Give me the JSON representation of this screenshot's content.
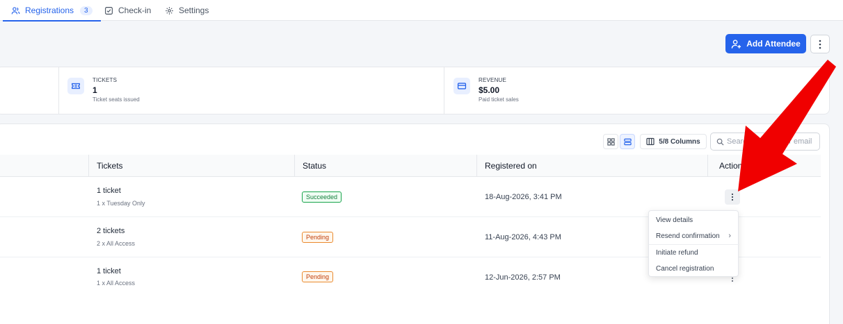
{
  "tabs": [
    {
      "label": "Registrations",
      "count": "3",
      "icon": "users-icon"
    },
    {
      "label": "Check-in",
      "icon": "checkbox-icon"
    },
    {
      "label": "Settings",
      "icon": "gear-icon"
    }
  ],
  "header": {
    "add_label": "Add Attendee"
  },
  "stats": {
    "tickets": {
      "label": "TICKETS",
      "value": "1",
      "sub": "Ticket seats issued"
    },
    "revenue": {
      "label": "REVENUE",
      "value": "$5.00",
      "sub": "Paid ticket sales"
    }
  },
  "toolbar": {
    "columns_label": "5/8 Columns",
    "search_placeholder": "Search by name or email"
  },
  "table": {
    "headers": [
      "Tickets",
      "Status",
      "Registered on",
      "Actions"
    ],
    "rows": [
      {
        "ticket": "1 ticket",
        "ticket_detail": "1 x Tuesday Only",
        "status": "Succeeded",
        "registered": "18-Aug-2026, 3:41 PM"
      },
      {
        "ticket": "2 tickets",
        "ticket_detail": "2 x All Access",
        "status": "Pending",
        "registered": "11-Aug-2026, 4:43 PM"
      },
      {
        "ticket": "1 ticket",
        "ticket_detail": "1 x All Access",
        "status": "Pending",
        "registered": "12-Jun-2026, 2:57 PM"
      }
    ]
  },
  "menu": {
    "items": [
      "View details",
      "Resend confirmation",
      "Initiate refund",
      "Cancel registration"
    ]
  },
  "colors": {
    "accent": "#2563eb",
    "arrow": "#f00000",
    "succeeded": "#16a34a",
    "pending": "#ea8a2e"
  }
}
